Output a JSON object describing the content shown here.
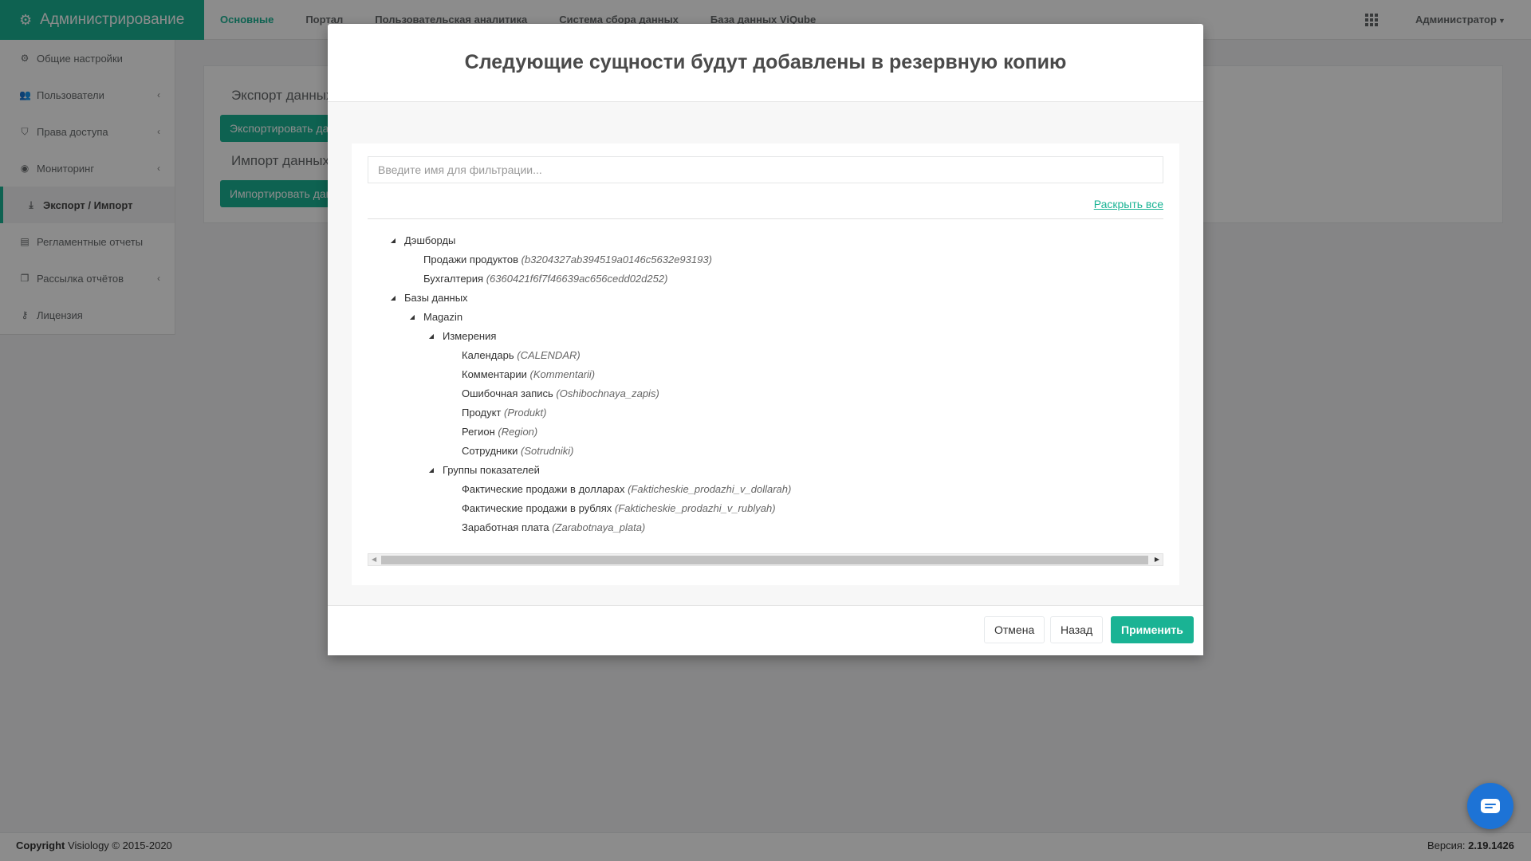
{
  "brand": {
    "title": "Администрирование",
    "icon": "gears-icon"
  },
  "topnav": {
    "items": [
      {
        "label": "Основные",
        "active": true
      },
      {
        "label": "Портал"
      },
      {
        "label": "Пользовательская аналитика"
      },
      {
        "label": "Система сбора данных"
      },
      {
        "label": "База данных ViQube"
      }
    ],
    "apps_icon": "grid-icon",
    "user_label": "Администратор"
  },
  "sidebar": {
    "items": [
      {
        "label": "Общие настройки",
        "icon": "gear-icon"
      },
      {
        "label": "Пользователи",
        "icon": "users-icon",
        "has_children": true
      },
      {
        "label": "Права доступа",
        "icon": "shield-icon",
        "has_children": true
      },
      {
        "label": "Мониторинг",
        "icon": "monitor-icon",
        "has_children": true
      },
      {
        "label": "Экспорт / Импорт",
        "icon": "download-icon",
        "active": true
      },
      {
        "label": "Регламентные отчеты",
        "icon": "report-icon"
      },
      {
        "label": "Рассылка отчётов",
        "icon": "copy-icon",
        "has_children": true
      },
      {
        "label": "Лицензия",
        "icon": "key-icon"
      }
    ]
  },
  "background": {
    "export_title": "Экспорт данных",
    "export_button": "Экспортировать данные",
    "import_title": "Импорт данных",
    "import_button": "Импортировать данные"
  },
  "modal": {
    "title": "Следующие сущности будут добавлены в резервную копию",
    "filter_placeholder": "Введите имя для фильтрации...",
    "expand_all": "Раскрыть все",
    "tree": [
      {
        "label": "Дэшборды",
        "level": 0,
        "expandable": true
      },
      {
        "label": "Продажи продуктов",
        "id": "(b3204327ab394519a0146c5632e93193)",
        "level": 1
      },
      {
        "label": "Бухгалтерия",
        "id": "(6360421f6f7f46639ac656cedd02d252)",
        "level": 1
      },
      {
        "label": "Базы данных",
        "level": 0,
        "expandable": true
      },
      {
        "label": "Magazin",
        "level": 1,
        "expandable": true
      },
      {
        "label": "Измерения",
        "level": 2,
        "expandable": true
      },
      {
        "label": "Календарь",
        "id": "(CALENDAR)",
        "level": 3
      },
      {
        "label": "Комментарии",
        "id": "(Kommentarii)",
        "level": 3
      },
      {
        "label": "Ошибочная запись",
        "id": "(Oshibochnaya_zapis)",
        "level": 3
      },
      {
        "label": "Продукт",
        "id": "(Produkt)",
        "level": 3
      },
      {
        "label": "Регион",
        "id": "(Region)",
        "level": 3
      },
      {
        "label": "Сотрудники",
        "id": "(Sotrudniki)",
        "level": 3
      },
      {
        "label": "Группы показателей",
        "level": 2,
        "expandable": true
      },
      {
        "label": "Фактические продажи в долларах",
        "id": "(Fakticheskie_prodazhi_v_dollarah)",
        "level": 3
      },
      {
        "label": "Фактические продажи в рублях",
        "id": "(Fakticheskie_prodazhi_v_rublyah)",
        "level": 3
      },
      {
        "label": "Заработная плата",
        "id": "(Zarabotnaya_plata)",
        "level": 3
      }
    ],
    "buttons": {
      "cancel": "Отмена",
      "back": "Назад",
      "apply": "Применить"
    }
  },
  "footer": {
    "copyright_bold": "Copyright",
    "copyright_text": "Visiology © 2015-2020",
    "version_label": "Версия:",
    "version_value": "2.19.1426"
  },
  "colors": {
    "accent": "#1ab394",
    "chat": "#1d73d6"
  },
  "chat": {
    "icon": "chat-icon"
  }
}
